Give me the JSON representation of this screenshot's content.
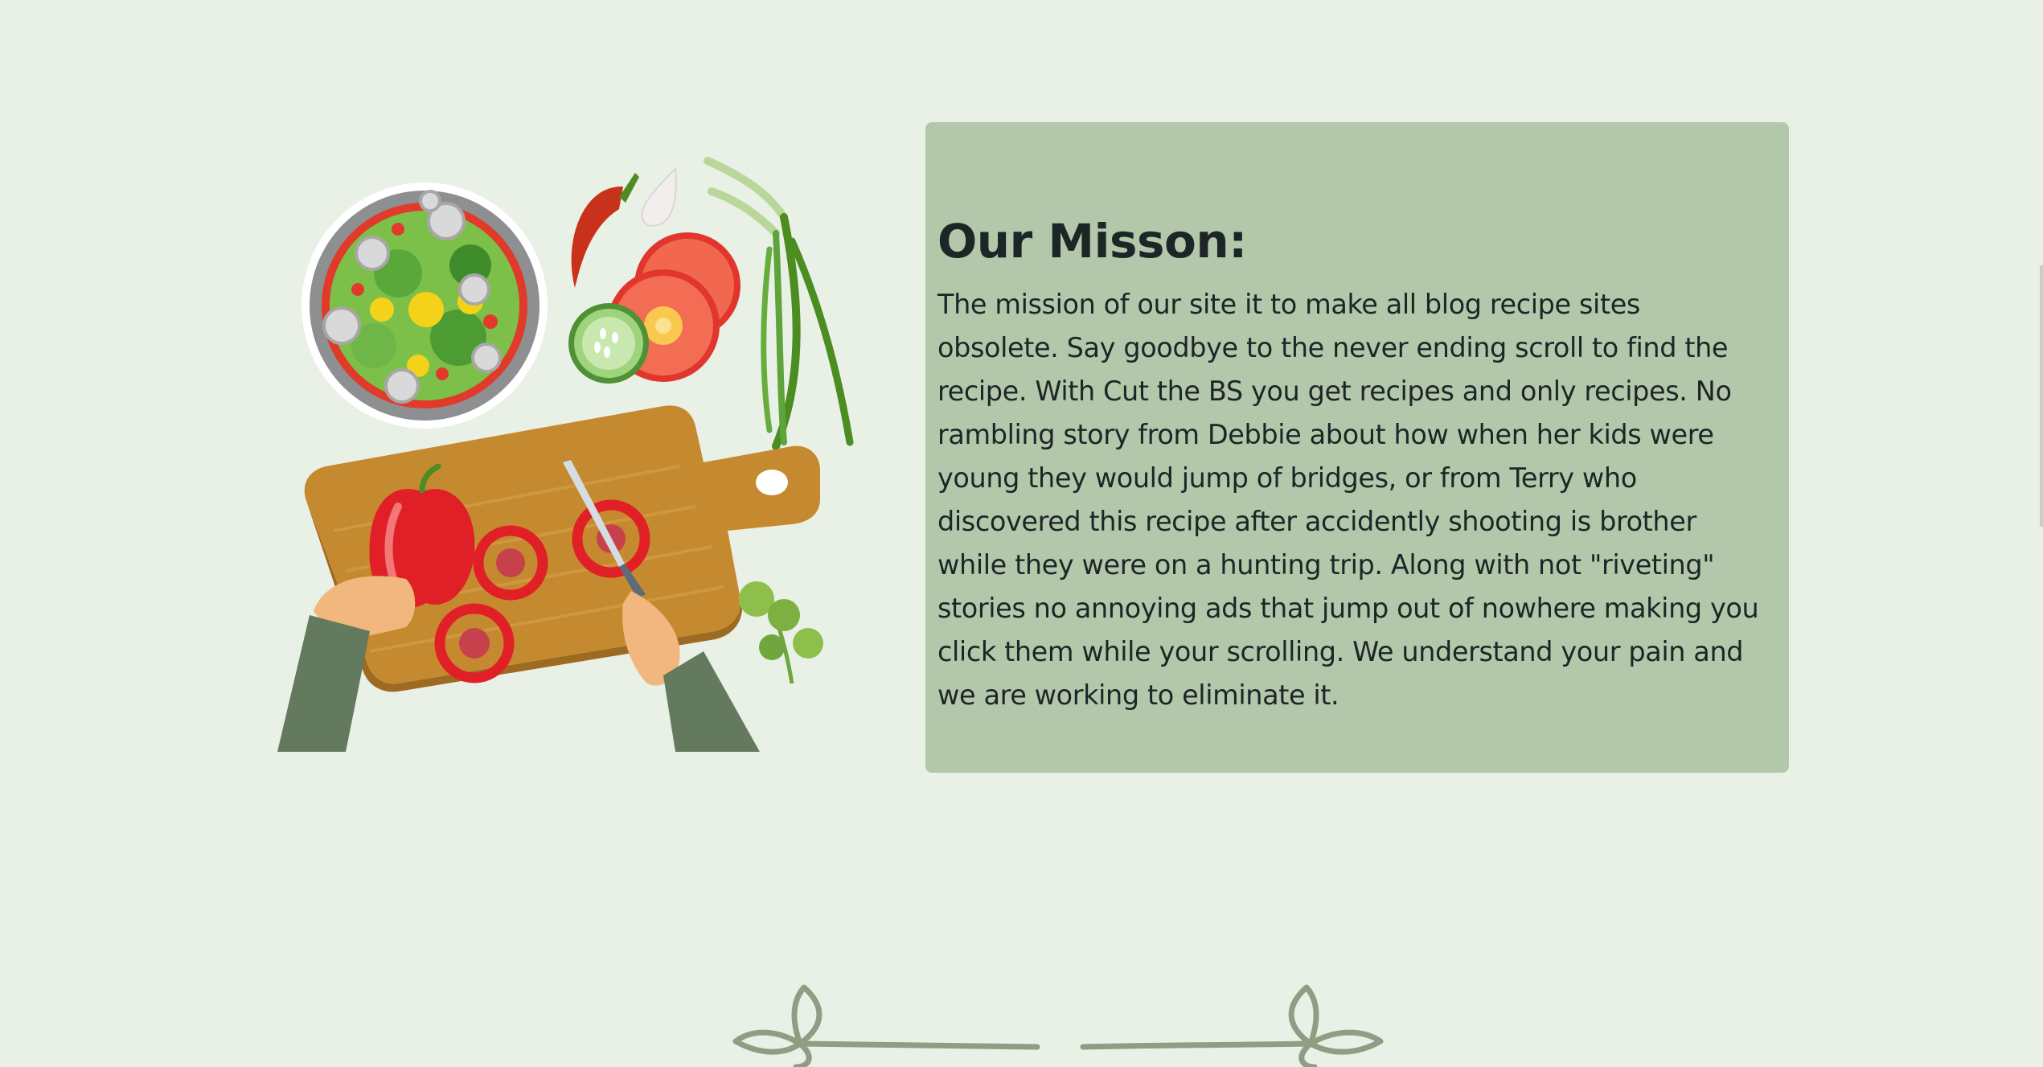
{
  "mission": {
    "title": "Our Misson:",
    "text": "The mission of our site it to make all blog recipe sites obsolete. Say goodbye to the never ending scroll to find the recipe. With Cut the BS you get recipes and only recipes. No rambling story from Debbie about how when her kids were young they would jump of bridges, or from Terry who discovered this recipe after accidently shooting is brother while they were on a hunting trip. Along with not \"riveting\" stories no annoying ads that jump out of nowhere making you click them while your scrolling. We understand your pain and we are working to eliminate it."
  },
  "illustration": {
    "icon": "cooking-illustration"
  },
  "divider": {
    "icon": "leaf-arrow-divider-icon"
  },
  "colors": {
    "background": "#e9f0e6",
    "card": "#b3c8ab",
    "text": "#1c2626",
    "divider": "#8f9d83"
  }
}
